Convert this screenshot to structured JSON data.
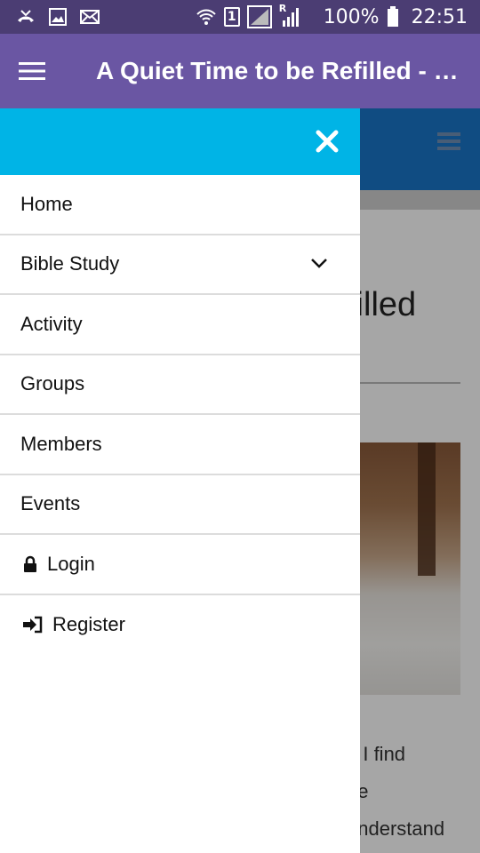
{
  "status_bar": {
    "battery": "100%",
    "time": "22:51",
    "sim_label": "1",
    "roaming_label": "R",
    "icons": [
      "missed-call-icon",
      "image-icon",
      "mail-icon",
      "wifi-icon",
      "sim-icon",
      "signal-icon",
      "battery-icon"
    ]
  },
  "app_bar": {
    "title": "A Quiet Time to be Refilled - Bible Study",
    "menu_icon": "hamburger-icon",
    "background": "#6a56a3"
  },
  "background_page": {
    "header_color": "#1976c8",
    "title_fragment": "filled",
    "text_lines": [
      "o I find",
      "he",
      "understand"
    ]
  },
  "drawer": {
    "header_color": "#00b4e6",
    "close_icon": "close-icon",
    "items": [
      {
        "label": "Home"
      },
      {
        "label": "Bible Study",
        "icon": "chevron-down-icon"
      },
      {
        "label": "Activity"
      },
      {
        "label": "Groups"
      },
      {
        "label": "Members"
      },
      {
        "label": "Events"
      },
      {
        "label": "Login",
        "icon": "lock-icon"
      },
      {
        "label": "Register",
        "icon": "sign-in-icon"
      }
    ]
  }
}
